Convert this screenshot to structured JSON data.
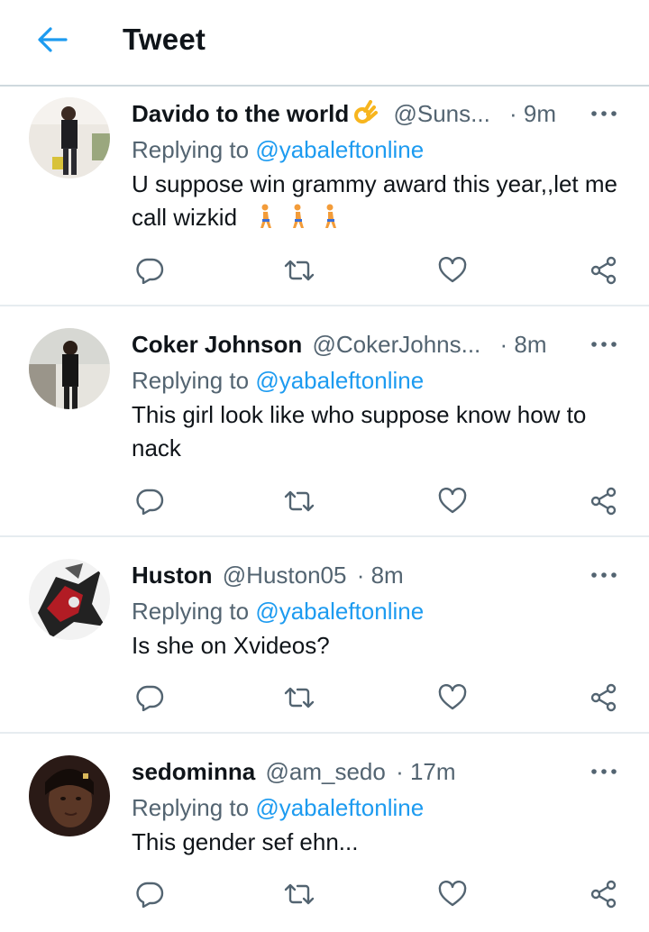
{
  "header": {
    "title": "Tweet"
  },
  "tweets": [
    {
      "name": "Davido to the world",
      "name_emoji": "ok-hand",
      "handle": "@Suns...",
      "time": "· 9m",
      "replying_prefix": "Replying to",
      "replying_to": "@yabaleftonline",
      "text": "U suppose win grammy award this year,,let me call wizkid",
      "text_emoji": "walking-person x3"
    },
    {
      "name": "Coker Johnson",
      "handle": "@CokerJohns...",
      "time": "· 8m",
      "replying_prefix": "Replying to",
      "replying_to": "@yabaleftonline",
      "text": "This girl look like who suppose know how to nack"
    },
    {
      "name": "Huston",
      "handle": "@Huston05",
      "time": "· 8m",
      "replying_prefix": "Replying to",
      "replying_to": "@yabaleftonline",
      "text": "Is she on Xvideos?"
    },
    {
      "name": "sedominna",
      "handle": "@am_sedo",
      "time": "· 17m",
      "replying_prefix": "Replying to",
      "replying_to": "@yabaleftonline",
      "text": "This gender sef ehn..."
    }
  ],
  "icons": {
    "back": "back-arrow-icon",
    "more": "more-options-icon",
    "reply": "reply-icon",
    "retweet": "retweet-icon",
    "like": "like-icon",
    "share": "share-icon"
  },
  "colors": {
    "accent": "#1d9bf0",
    "secondary_text": "#536471",
    "divider": "#e6ecf0"
  }
}
